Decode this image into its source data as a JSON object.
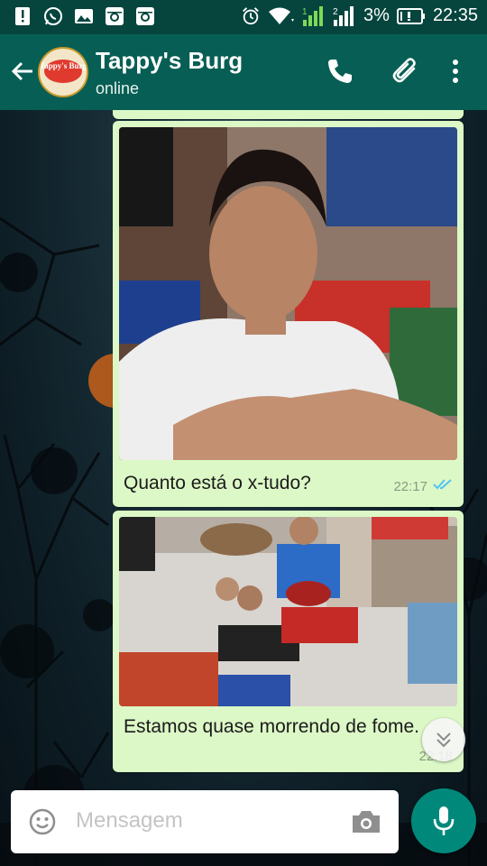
{
  "status_bar": {
    "battery": "3%",
    "time": "22:35",
    "icons": [
      "alert-icon",
      "whatsapp-icon",
      "gallery-icon",
      "instagram-icon",
      "instagram-icon",
      "alarm-icon",
      "wifi-icon",
      "signal-1-icon",
      "signal-2-icon",
      "battery-icon"
    ]
  },
  "header": {
    "contact_name": "Tappy's Burg",
    "status": "online",
    "avatar_text": "Tappy's Burg",
    "icons": [
      "back-arrow-icon",
      "phone-icon",
      "attach-icon",
      "more-vert-icon"
    ]
  },
  "messages": [
    {
      "type": "image",
      "caption": "Quanto está o x-tudo?",
      "time": "22:17",
      "read": true
    },
    {
      "type": "image",
      "caption": "Estamos quase morrendo de fome.",
      "time": "22:18",
      "read": true
    }
  ],
  "composer": {
    "placeholder": "Mensagem",
    "icons": [
      "emoji-icon",
      "camera-icon",
      "mic-icon"
    ]
  },
  "colors": {
    "status_bar": "#06453e",
    "app_bar": "#075e54",
    "bubble": "#dcf8c6",
    "read_tick": "#4fc3f7",
    "mic_button": "#00897b"
  }
}
